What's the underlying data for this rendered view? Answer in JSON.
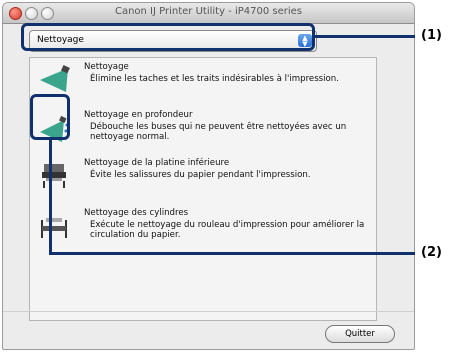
{
  "window": {
    "title": "Canon IJ Printer Utility - iP4700 series"
  },
  "dropdown": {
    "selected": "Nettoyage",
    "arrow_icon": "updown-arrows-icon"
  },
  "items": [
    {
      "title": "Nettoyage",
      "description": "Élimine les taches et les traits indésirables à l'impression.",
      "icon": "cleaning-nozzle-icon"
    },
    {
      "title": "Nettoyage en profondeur",
      "description": "Débouche les buses qui ne peuvent être nettoyées avec un nettoyage normal.",
      "icon": "deep-cleaning-icon"
    },
    {
      "title": "Nettoyage de la platine inférieure",
      "description": "Évite les salissures du papier pendant l'impression.",
      "icon": "bottom-plate-cleaning-icon"
    },
    {
      "title": "Nettoyage des cylindres",
      "description": "Exécute le nettoyage du rouleau d'impression pour améliorer la circulation du papier.",
      "icon": "roller-cleaning-icon"
    }
  ],
  "buttons": {
    "quit": "Quitter"
  },
  "callouts": {
    "one": "(1)",
    "two": "(2)"
  },
  "colors": {
    "callout": "#10306e",
    "accent": "#2a6fd6"
  }
}
